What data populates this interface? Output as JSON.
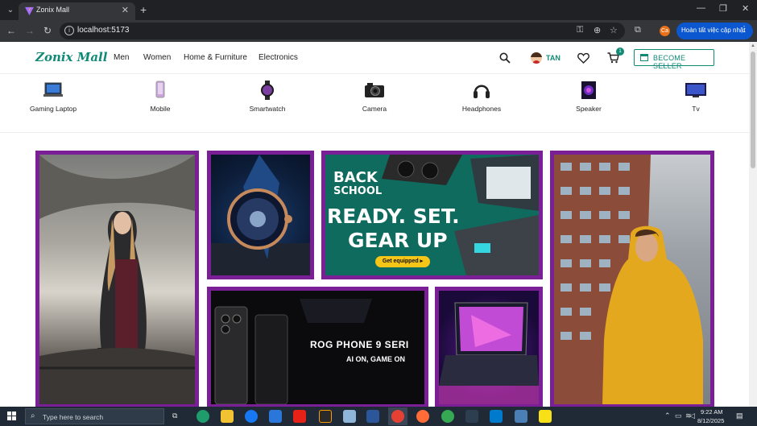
{
  "browser": {
    "tab_title": "Zonix Mall",
    "tab_close": "✕",
    "new_tab": "+",
    "url": "localhost:5173",
    "profile_initial": "Ca",
    "update_label": "Hoàn tất việc cập nhật",
    "window_minimize": "—",
    "window_restore": "❐",
    "window_close": "✕"
  },
  "header": {
    "logo": "Zonix Mall",
    "nav": [
      "Men",
      "Women",
      "Home & Furniture",
      "Electronics"
    ],
    "user_name": "TAN",
    "cart_count": "1",
    "seller_button": "BECOME SELLER"
  },
  "categories": [
    {
      "label": "Gaming Laptop",
      "icon": "laptop-icon"
    },
    {
      "label": "Mobile",
      "icon": "mobile-icon"
    },
    {
      "label": "Smartwatch",
      "icon": "smartwatch-icon"
    },
    {
      "label": "Camera",
      "icon": "camera-icon"
    },
    {
      "label": "Headphones",
      "icon": "headphones-icon"
    },
    {
      "label": "Speaker",
      "icon": "speaker-icon"
    },
    {
      "label": "Tv",
      "icon": "tv-icon"
    }
  ],
  "banners": {
    "back_to_school": {
      "line1": "BACK",
      "line2": "SCHOOL",
      "headline1": "READY. SET.",
      "headline2": "GEAR UP",
      "cta": "Get equipped ▸"
    },
    "rog_phone": {
      "title": "ROG PHONE 9 SERI",
      "subtitle": "AI ON, GAME ON"
    }
  },
  "taskbar": {
    "search_placeholder": "Type here to search",
    "time": "9:22 AM",
    "date": "8/12/2025"
  },
  "colors": {
    "brand": "#0f8a76",
    "banner_border": "#7b1f96",
    "update_button": "#0b57d0"
  }
}
